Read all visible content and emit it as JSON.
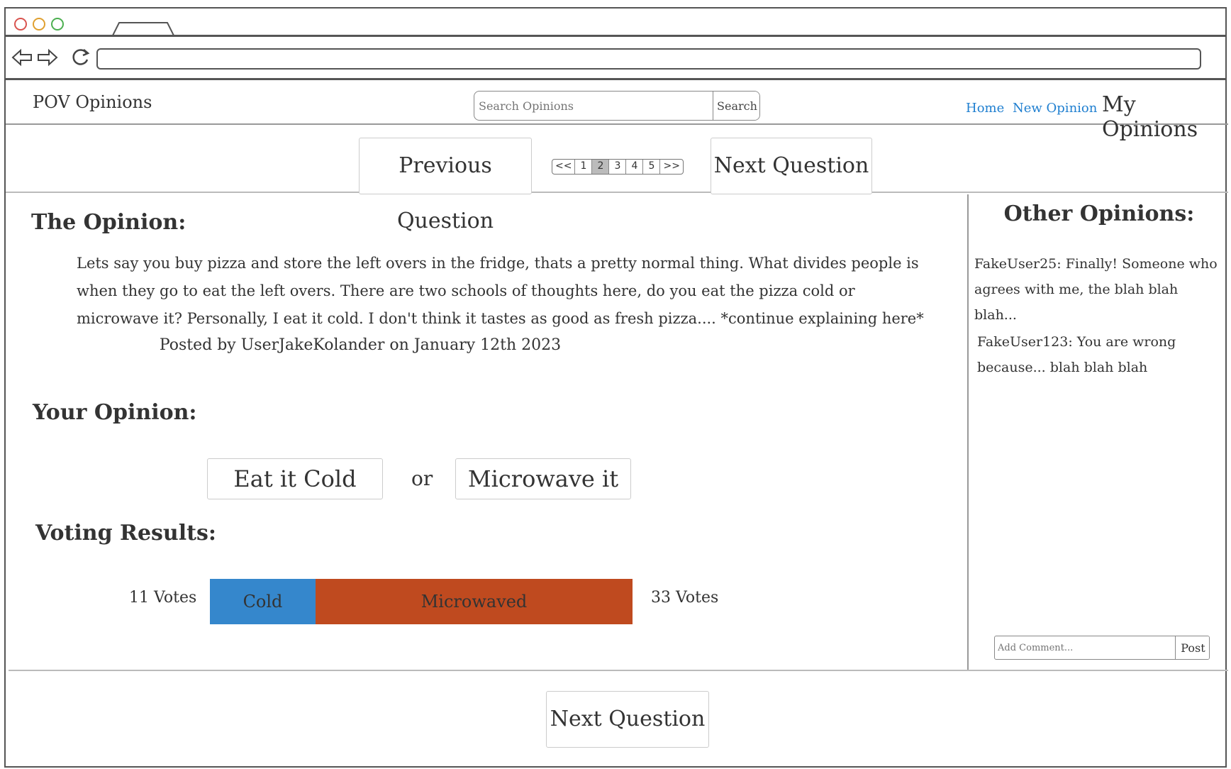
{
  "browser": {
    "back_icon": "back-arrow-icon",
    "forward_icon": "forward-arrow-icon",
    "reload_icon": "reload-icon",
    "address": ""
  },
  "header": {
    "logo": "POV Opinions",
    "search_placeholder": "Search Opinions",
    "search_button": "Search",
    "nav": {
      "home": "Home",
      "new_opinion": "New Opinion",
      "my_opinions": "My Opinions"
    }
  },
  "question_nav": {
    "previous": "Previous Question",
    "next": "Next Question",
    "pager": {
      "first": "<<",
      "pages": [
        "1",
        "2",
        "3",
        "4",
        "5"
      ],
      "last": ">>",
      "active_page": "2"
    }
  },
  "opinion": {
    "heading": "The Opinion:",
    "text": "Lets say you buy pizza and store the left overs in the fridge, thats a pretty normal thing. What divides people is when they go to eat the left overs. There are two schools of thoughts here, do you eat the pizza cold or microwave it? Personally, I eat it cold. I don't think it tastes as good as fresh pizza.... *continue explaining here*",
    "posted_by": "Posted by UserJakeKolander on January 12th 2023"
  },
  "your_opinion": {
    "heading": "Your Opinion:",
    "option_a": "Eat it Cold",
    "separator": "or",
    "option_b": "Microwave it"
  },
  "voting": {
    "heading": "Voting Results:",
    "cold_votes_label": "11 Votes",
    "microwaved_votes_label": "33 Votes",
    "cold_label": "Cold",
    "microwaved_label": "Microwaved",
    "cold_votes": 11,
    "microwaved_votes": 33,
    "cold_color": "#3587cc",
    "microwaved_color": "#bf4a1f"
  },
  "other_opinions": {
    "heading": "Other Opinions:",
    "comments": [
      {
        "user": "FakeUser25:",
        "text": "Finally! Someone who agrees with me, the blah blah blah..."
      },
      {
        "user": "FakeUser123:",
        "text": "You are wrong because... blah blah blah"
      }
    ],
    "add_placeholder": "Add Comment...",
    "post_button": "Post"
  },
  "footer": {
    "next": "Next Question"
  }
}
